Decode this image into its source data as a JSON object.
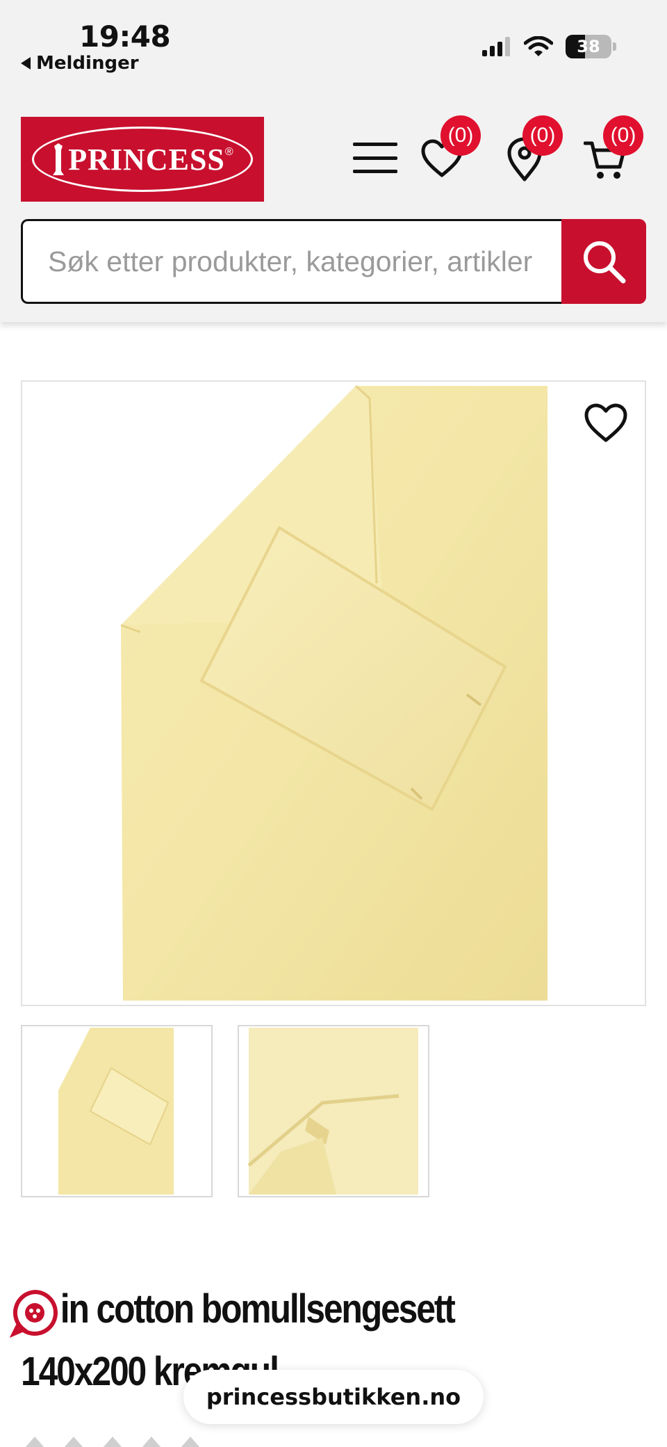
{
  "status_bar": {
    "time": "19:48",
    "back_label": "Meldinger",
    "battery": "38"
  },
  "header": {
    "logo_text": "PRINCESS",
    "logo_mark": "®",
    "wishlist_count": "(0)",
    "stores_count": "(0)",
    "cart_count": "(0)",
    "colors": {
      "brand_red": "#c8102e",
      "badge_red": "#e0102e"
    }
  },
  "search": {
    "placeholder": "Søk etter produkter, kategorier, artikler"
  },
  "product": {
    "title_line1": "in cotton bomullsengesett",
    "title_line2": "140x200 kremgul",
    "main_image": "yellow-duvet-set-photo",
    "thumbnails": [
      "duvet-set-thumbnail",
      "pillow-zipper-detail-thumbnail"
    ],
    "color": "#f3e6a6"
  },
  "browser": {
    "url": "princessbutikken.no"
  }
}
